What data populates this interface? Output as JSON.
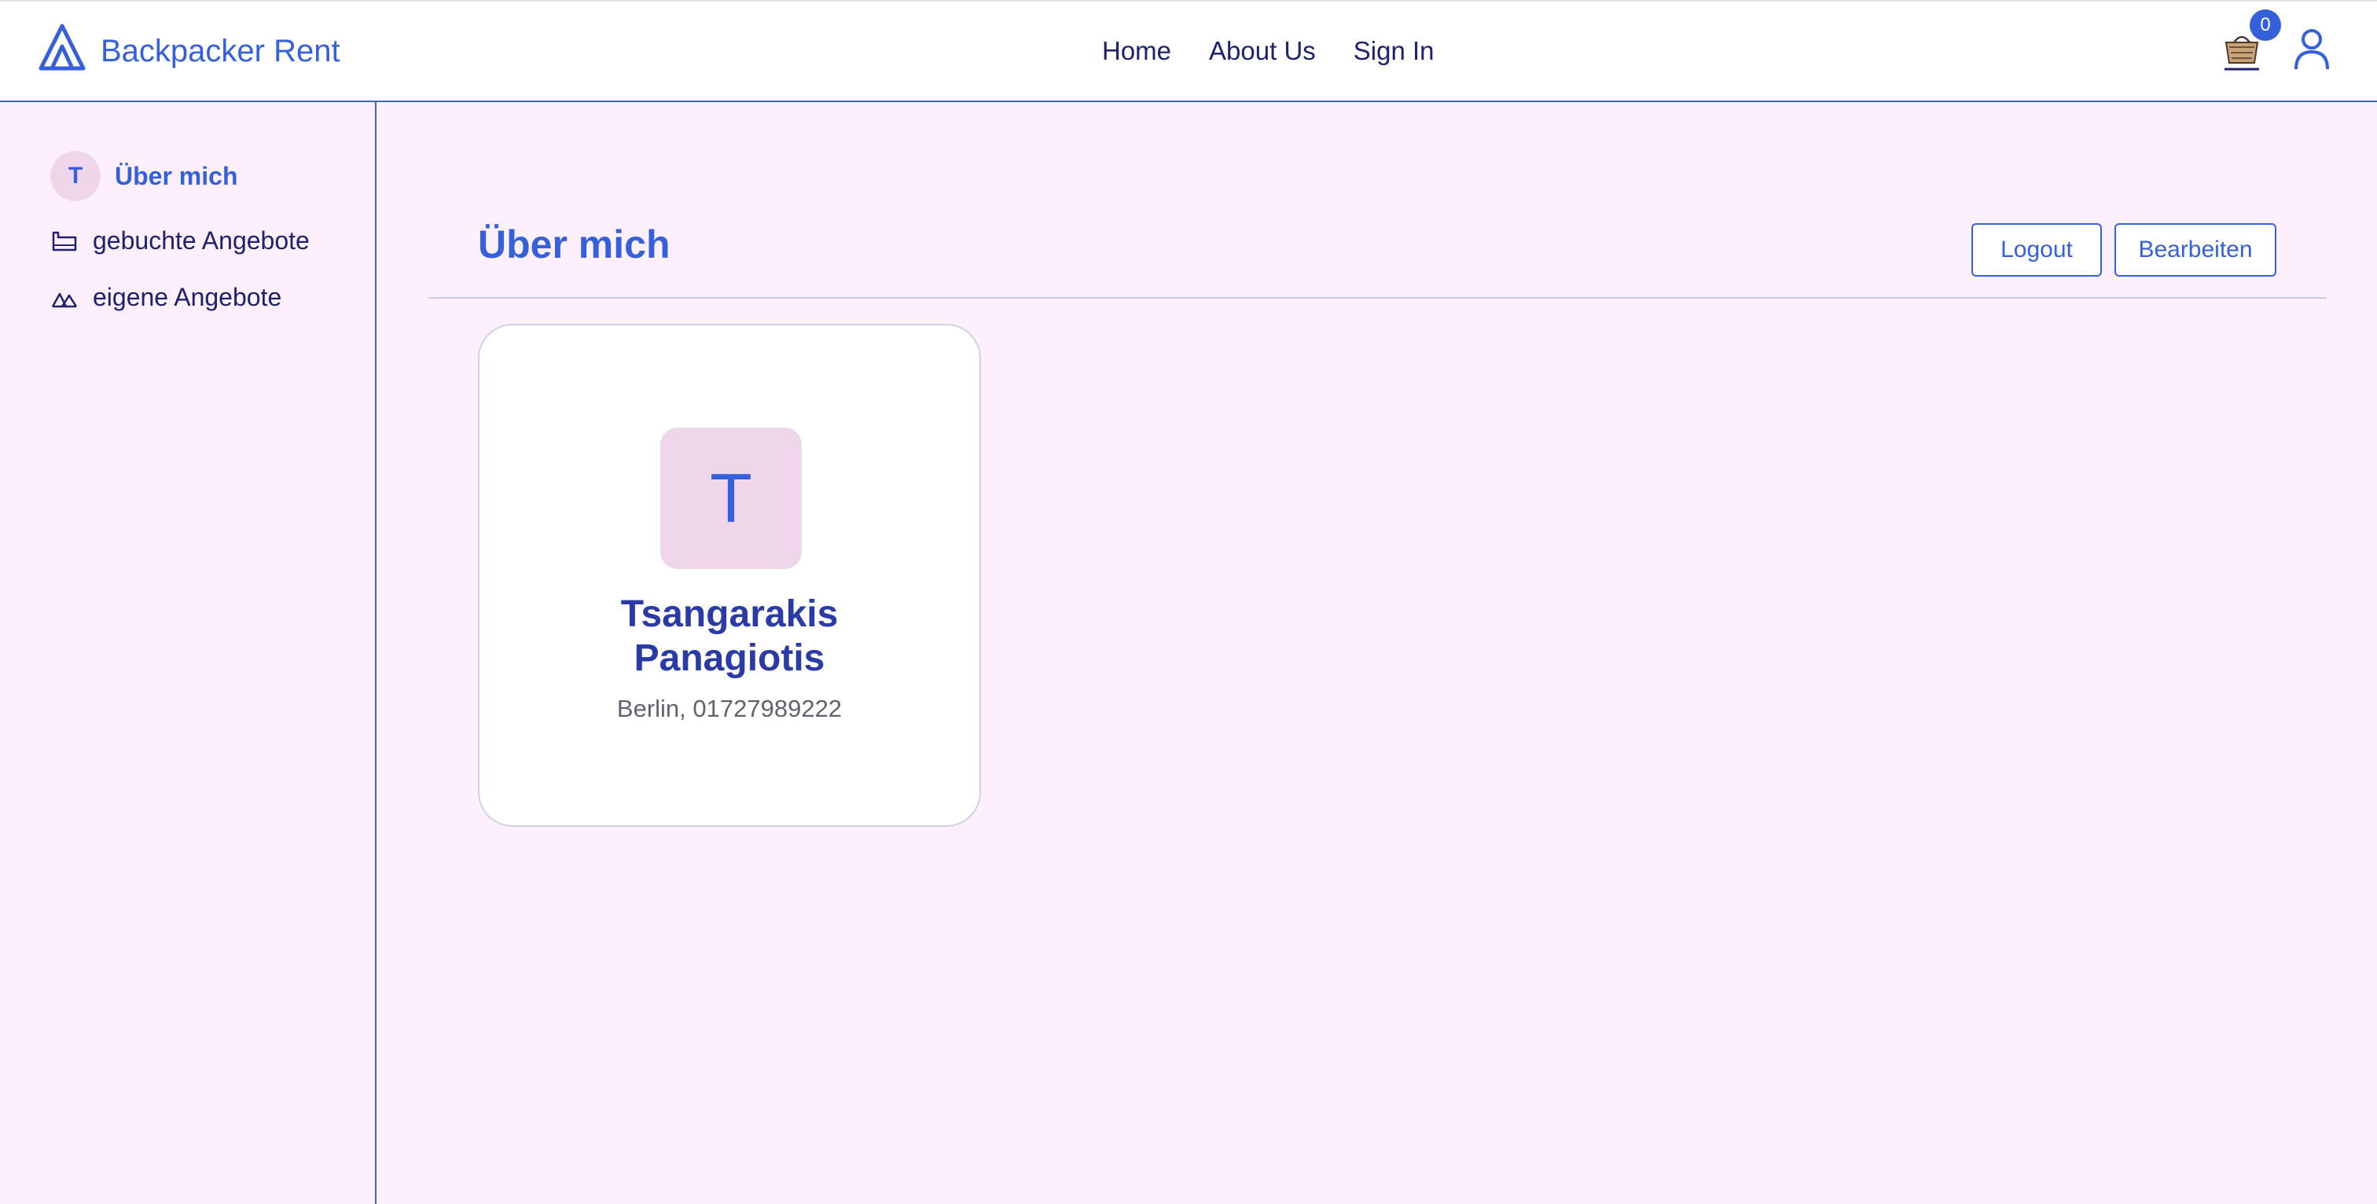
{
  "brand": {
    "name": "Backpacker Rent",
    "icon": "mountain-logo-icon"
  },
  "nav": {
    "home": "Home",
    "about": "About Us",
    "signin": "Sign In"
  },
  "header": {
    "cart_count": "0",
    "cart_icon": "cart-icon",
    "user_icon": "user-icon"
  },
  "sidebar": {
    "avatar_letter": "T",
    "items": [
      {
        "label": "Über mich",
        "icon": "avatar"
      },
      {
        "label": "gebuchte Angebote",
        "icon": "booking-icon"
      },
      {
        "label": "eigene Angebote",
        "icon": "mountains-icon"
      }
    ]
  },
  "main": {
    "title": "Über mich",
    "logout_label": "Logout",
    "edit_label": "Bearbeiten"
  },
  "profile": {
    "avatar_letter": "T",
    "last_name": "Tsangarakis",
    "first_name": "Panagiotis",
    "meta": "Berlin, 01727989222"
  },
  "colors": {
    "accent": "#3560dc",
    "background": "#fdf0fc",
    "avatar_bg": "#efd6ea",
    "nav_text": "#1c2170"
  }
}
